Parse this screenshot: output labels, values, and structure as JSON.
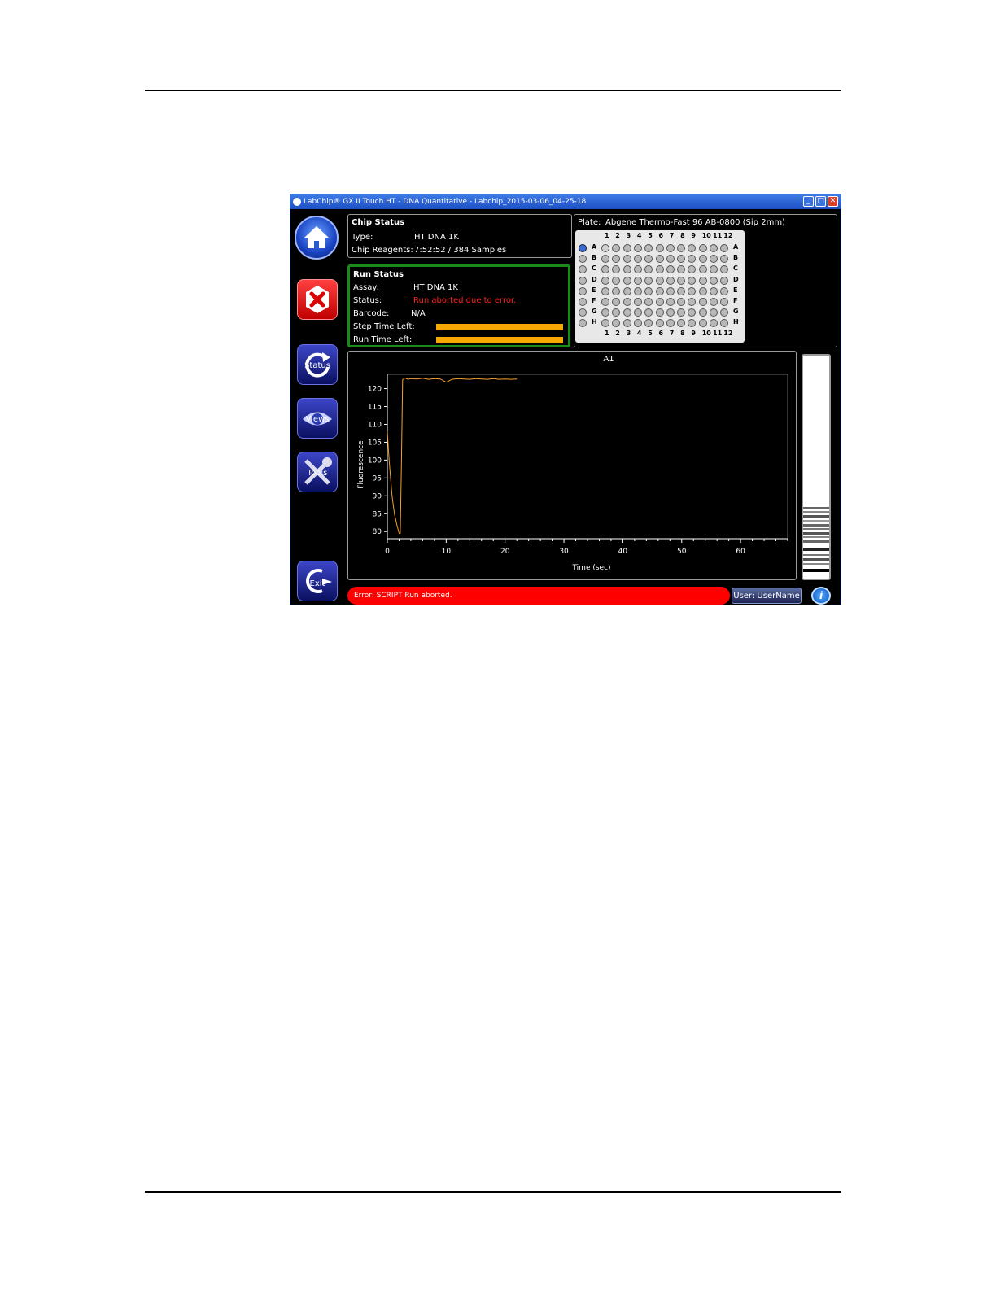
{
  "window": {
    "title": "LabChip® GX II Touch HT - DNA Quantitative - Labchip_2015-03-06_04-25-18",
    "btn_min": "_",
    "btn_max": "□",
    "btn_close": "✕"
  },
  "sidebar": {
    "status_label": "Status",
    "views_label": "Views",
    "tools_label": "Tools",
    "exit_label": "Exit"
  },
  "chip_status": {
    "heading": "Chip Status",
    "type_label": "Type:",
    "type_value": "HT DNA 1K",
    "reagents_label": "Chip Reagents:",
    "reagents_value": "7:52:52 / 384 Samples"
  },
  "run_status": {
    "heading": "Run Status",
    "assay_label": "Assay:",
    "assay_value": "HT DNA 1K",
    "status_label": "Status:",
    "status_value": "Run aborted due to error.",
    "barcode_label": "Barcode:",
    "barcode_value": "N/A",
    "step_label": "Step Time Left:",
    "run_label": "Run Time Left:",
    "step_progress": 1.0,
    "run_progress": 1.0
  },
  "plate": {
    "label": "Plate:",
    "name": "Abgene Thermo-Fast 96 AB-0800 (Sip 2mm)",
    "columns": [
      "1",
      "2",
      "3",
      "4",
      "5",
      "6",
      "7",
      "8",
      "9",
      "10",
      "11",
      "12"
    ],
    "rows": [
      "A",
      "B",
      "C",
      "D",
      "E",
      "F",
      "G",
      "H"
    ],
    "selected_well": "A1"
  },
  "chart_data": {
    "type": "line",
    "title": "A1",
    "xlabel": "Time (sec)",
    "ylabel": "Fluorescence",
    "xlim": [
      0,
      68
    ],
    "ylim": [
      78,
      124
    ],
    "xticks": [
      0,
      10,
      20,
      30,
      40,
      50,
      60
    ],
    "yticks": [
      80,
      85,
      90,
      95,
      100,
      105,
      110,
      115,
      120
    ],
    "series": [
      {
        "color": "#f5a030",
        "x": [
          0,
          0.3,
          0.8,
          1.2,
          1.6,
          2.0,
          2.2,
          2.4,
          2.6,
          3.0,
          3.5,
          4,
          5,
          6,
          7,
          8,
          9,
          10,
          11,
          12,
          13,
          14,
          15,
          16,
          17,
          18,
          19,
          20,
          21,
          22
        ],
        "y": [
          108,
          100,
          90,
          85,
          82,
          79.5,
          79.5,
          100,
          122.5,
          123,
          122.6,
          122.8,
          122.7,
          122.9,
          122.6,
          122.8,
          122.7,
          121.8,
          122.6,
          122.8,
          122.7,
          122.6,
          122.8,
          122.7,
          122.6,
          122.8,
          122.6,
          122.7,
          122.6,
          122.7
        ]
      }
    ]
  },
  "footer": {
    "error_text": "Error: SCRIPT Run  aborted.",
    "user_label": "User: UserName",
    "info": "i"
  }
}
